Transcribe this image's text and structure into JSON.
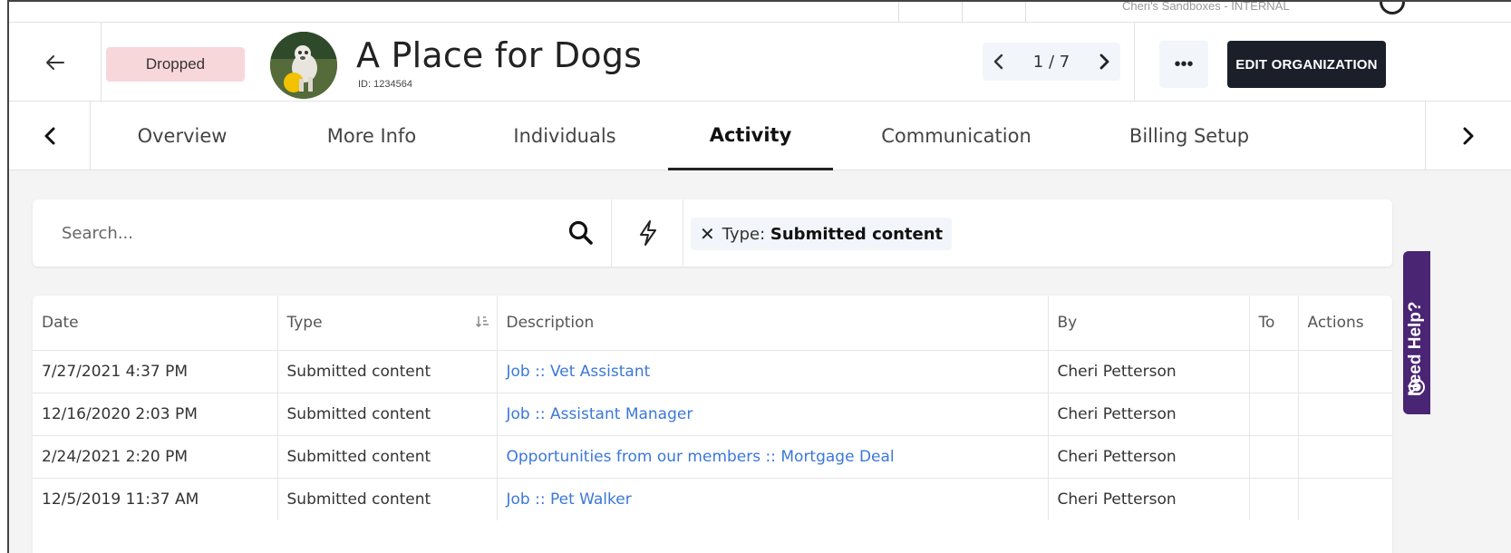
{
  "topbar": {
    "cut_text": "Cheri's Sandboxes - INTERNAL"
  },
  "header": {
    "status": "Dropped",
    "org_name": "A Place for Dogs",
    "org_id": "ID: 1234564",
    "pager_count": "1 / 7",
    "more_label": "•••",
    "edit_label": "EDIT ORGANIZATION"
  },
  "tabs": [
    {
      "label": "Overview"
    },
    {
      "label": "More Info"
    },
    {
      "label": "Individuals"
    },
    {
      "label": "Activity",
      "active": true
    },
    {
      "label": "Communication"
    },
    {
      "label": "Billing Setup"
    }
  ],
  "search": {
    "placeholder": "Search...",
    "filter_prefix": "Type",
    "filter_value": "Submitted content"
  },
  "table": {
    "headers": [
      "Date",
      "Type",
      "Description",
      "By",
      "To",
      "Actions"
    ],
    "rows": [
      {
        "date": "7/27/2021 4:37 PM",
        "type": "Submitted content",
        "description": "Job :: Vet Assistant",
        "by": "Cheri Petterson"
      },
      {
        "date": "12/16/2020 2:03 PM",
        "type": "Submitted content",
        "description": "Job :: Assistant Manager",
        "by": "Cheri Petterson"
      },
      {
        "date": "2/24/2021 2:20 PM",
        "type": "Submitted content",
        "description": "Opportunities from our members :: Mortgage Deal",
        "by": "Cheri Petterson"
      },
      {
        "date": "12/5/2019 11:37 AM",
        "type": "Submitted content",
        "description": "Job :: Pet Walker",
        "by": "Cheri Petterson"
      }
    ]
  },
  "help": {
    "label": "Need Help?"
  },
  "colors": {
    "status_bg": "#f8d7da",
    "edit_bg": "#1b1f2a",
    "link": "#3b78d8",
    "help_bg": "#4a2574"
  }
}
